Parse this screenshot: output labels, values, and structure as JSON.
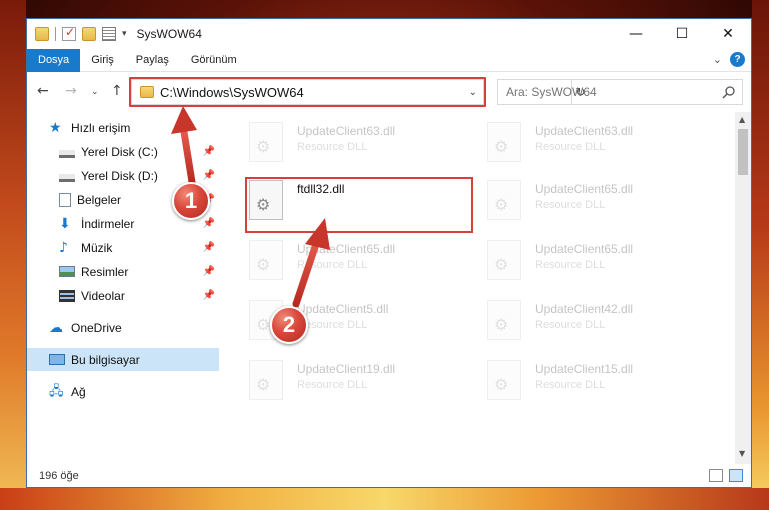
{
  "window": {
    "title": "SysWOW64",
    "controls": {
      "minimize": "—",
      "maximize": "☐",
      "close": "✕"
    }
  },
  "ribbon": {
    "tabs": [
      "Dosya",
      "Giriş",
      "Paylaş",
      "Görünüm"
    ],
    "active_tab": "Dosya",
    "help": "?"
  },
  "navigation": {
    "address": "C:\\Windows\\SysWOW64",
    "search_placeholder": "Ara: SysWOW64"
  },
  "sidebar": {
    "items": [
      {
        "label": "Hızlı erişim",
        "icon": "star-icon",
        "pinned": false
      },
      {
        "label": "Yerel Disk (C:)",
        "icon": "drive-icon",
        "pinned": true
      },
      {
        "label": "Yerel Disk (D:)",
        "icon": "drive-icon",
        "pinned": true
      },
      {
        "label": "Belgeler",
        "icon": "documents-icon",
        "pinned": true
      },
      {
        "label": "İndirmeler",
        "icon": "download-icon",
        "pinned": true
      },
      {
        "label": "Müzik",
        "icon": "music-icon",
        "pinned": true
      },
      {
        "label": "Resimler",
        "icon": "pictures-icon",
        "pinned": true
      },
      {
        "label": "Videolar",
        "icon": "video-icon",
        "pinned": true
      },
      {
        "label": "OneDrive",
        "icon": "cloud-icon",
        "pinned": false
      },
      {
        "label": "Bu bilgisayar",
        "icon": "computer-icon",
        "pinned": false,
        "selected": true
      },
      {
        "label": "Ağ",
        "icon": "network-icon",
        "pinned": false
      }
    ]
  },
  "files": [
    {
      "name": "UpdateClient63.dll",
      "desc": "Resource DLL",
      "faded": true
    },
    {
      "name": "UpdateClient63.dll",
      "desc": "Resource DLL",
      "faded": true
    },
    {
      "name": "ftdll32.dll",
      "desc": "",
      "faded": false
    },
    {
      "name": "UpdateClient65.dll",
      "desc": "Resource DLL",
      "faded": true
    },
    {
      "name": "UpdateClient65.dll",
      "desc": "Resource DLL",
      "faded": true
    },
    {
      "name": "UpdateClient65.dll",
      "desc": "Resource DLL",
      "faded": true
    },
    {
      "name": "UpdateClient5.dll",
      "desc": "Resource DLL",
      "faded": true
    },
    {
      "name": "UpdateClient42.dll",
      "desc": "Resource DLL",
      "faded": true
    },
    {
      "name": "UpdateClient19.dll",
      "desc": "Resource DLL",
      "faded": true
    },
    {
      "name": "UpdateClient15.dll",
      "desc": "Resource DLL",
      "faded": true
    }
  ],
  "status": {
    "item_count": "196 öğe"
  },
  "annotations": {
    "step1": "1",
    "step2": "2",
    "highlight_color": "#d6403a"
  }
}
